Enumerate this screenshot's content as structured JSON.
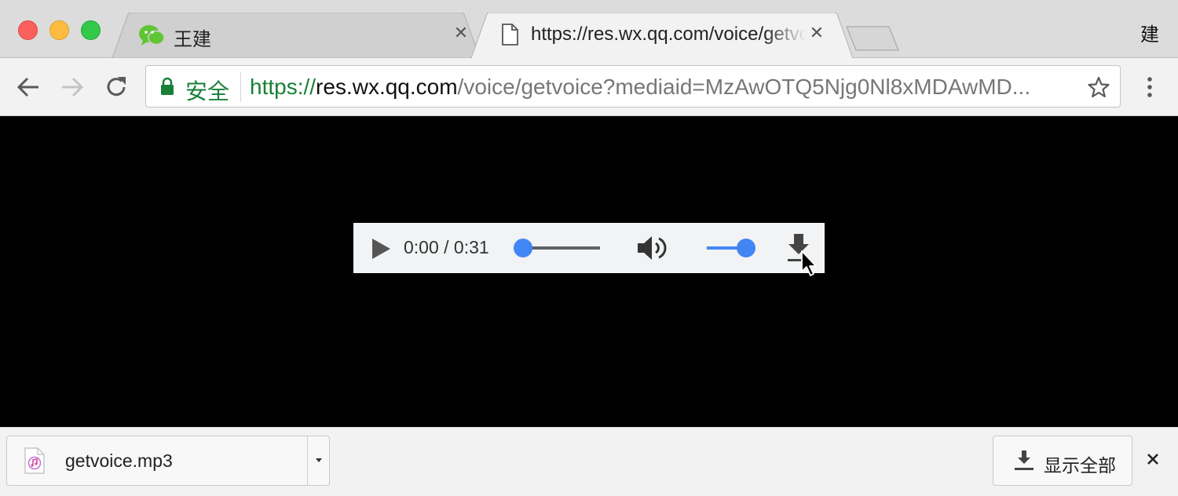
{
  "tabs": [
    {
      "title": "王建",
      "favicon": "wechat-icon",
      "active": false,
      "close": "✕"
    },
    {
      "title": "https://res.wx.qq.com/voice/getvoice",
      "favicon": "document-icon",
      "active": true,
      "close": "✕"
    }
  ],
  "profile": {
    "label": "建"
  },
  "omnibox": {
    "secure_label": "安全",
    "url_scheme": "https://",
    "url_host": "res.wx.qq.com",
    "url_path": "/voice/getvoice?mediaid=MzAwOTQ5Njg0Nl8xMDAwMD...",
    "icons": [
      "lock-icon",
      "star-icon"
    ]
  },
  "player": {
    "time": "0:00 / 0:31",
    "progress": 0.0,
    "volume": 1.0,
    "icons": [
      "play-icon",
      "volume-icon",
      "download-icon"
    ]
  },
  "download_shelf": {
    "file_name": "getvoice.mp3",
    "show_all_label": "显示全部",
    "icons": [
      "music-file-icon",
      "chevron-down-icon",
      "download-icon",
      "close-icon"
    ]
  },
  "colors": {
    "secure_green": "#188038",
    "accent_blue": "#4285f4",
    "tabstrip": "#dcdcdc",
    "toolbar": "#f2f2f2"
  }
}
